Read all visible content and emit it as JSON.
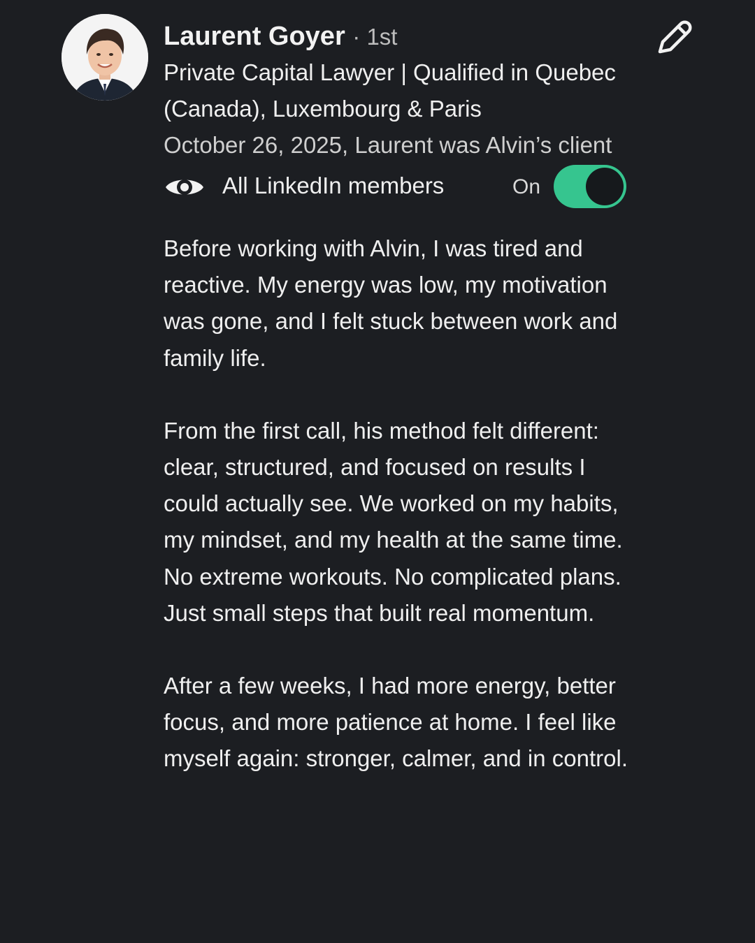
{
  "recommendation": {
    "author_name": "Laurent Goyer",
    "connection_degree": "· 1st",
    "headline": "Private Capital Lawyer | Qualified in Quebec (Canada), Luxembourg & Paris",
    "meta": "October 26, 2025, Laurent was Alvin’s client",
    "visibility_label": "All LinkedIn members",
    "toggle_state": "On",
    "paragraphs": [
      "Before working with Alvin, I was tired and reactive. My energy was low, my motivation was gone, and I felt stuck between work and family life.",
      "From the first call, his method felt different: clear, structured, and focused on results I could actually see. We worked on my habits, my mindset, and my health at the same time. No extreme workouts. No complicated plans. Just small steps that built real momentum.",
      "After a few weeks, I had more energy, better focus, and more patience at home. I feel like myself again: stronger, calmer, and in control."
    ]
  },
  "icons": {
    "edit": "pencil-icon",
    "visibility": "eye-icon",
    "avatar": "profile-photo"
  },
  "colors": {
    "background": "#1c1e22",
    "toggle_on": "#36c58f",
    "text": "#efefef",
    "muted_text": "#cfcfcf"
  }
}
